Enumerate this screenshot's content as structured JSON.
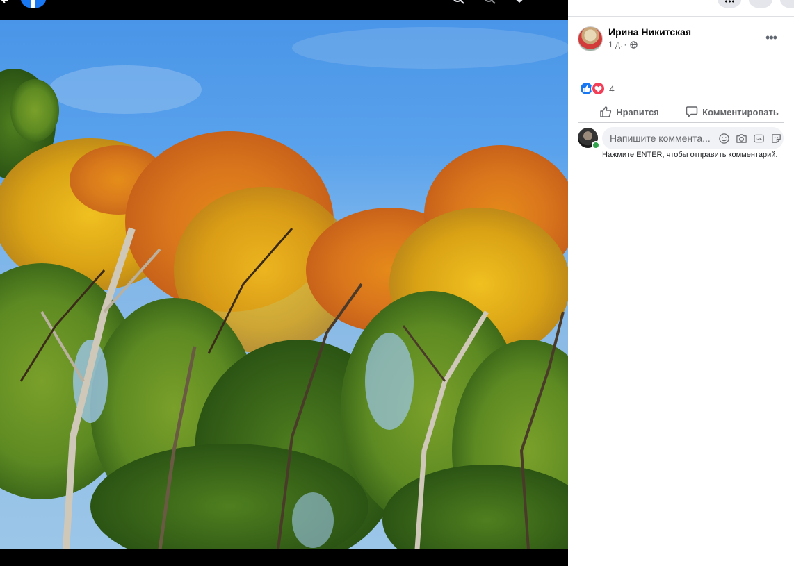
{
  "viewer": {
    "top_icons": [
      "zoom-in-icon",
      "zoom-out-icon",
      "tag-icon",
      "fullscreen-icon"
    ],
    "photo_alt": ""
  },
  "post": {
    "author": "Ирина Никитская",
    "time": "1 д.",
    "separator": "·",
    "privacy_icon": "globe-icon",
    "reaction_count": "4",
    "reaction_types": [
      "like",
      "love"
    ]
  },
  "actions": {
    "like_label": "Нравится",
    "comment_label": "Комментировать"
  },
  "comment": {
    "placeholder": "Напишите коммента...",
    "hint": "Нажмите ENTER, чтобы отправить комментарий.",
    "icons": [
      "emoji-icon",
      "camera-icon",
      "gif-icon",
      "sticker-icon"
    ]
  },
  "colors": {
    "brand": "#1877f2",
    "love": "#f33e58",
    "online": "#31a24c",
    "secondary_text": "#65676b"
  }
}
